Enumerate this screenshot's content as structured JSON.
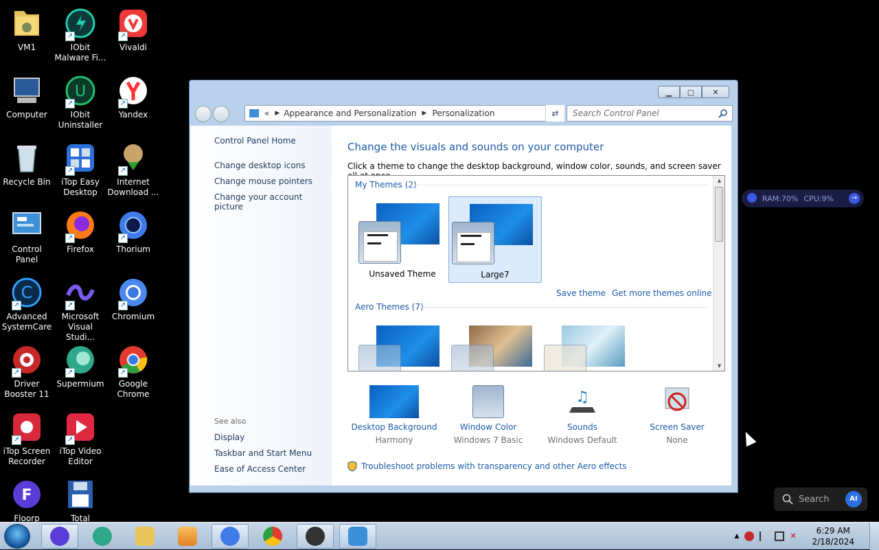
{
  "desktop": {
    "icons": [
      {
        "label": "VM1"
      },
      {
        "label": "IObit Malware Fi..."
      },
      {
        "label": "Vivaldi"
      },
      {
        "label": "Computer"
      },
      {
        "label": "IObit Uninstaller"
      },
      {
        "label": "Yandex"
      },
      {
        "label": "Recycle Bin"
      },
      {
        "label": "iTop Easy Desktop"
      },
      {
        "label": "Internet Download ..."
      },
      {
        "label": "Control Panel"
      },
      {
        "label": "Firefox"
      },
      {
        "label": "Thorium"
      },
      {
        "label": "Advanced SystemCare"
      },
      {
        "label": "Microsoft Visual Studi..."
      },
      {
        "label": "Chromium"
      },
      {
        "label": "Driver Booster 11"
      },
      {
        "label": "Supermium"
      },
      {
        "label": "Google Chrome"
      },
      {
        "label": "iTop Screen Recorder"
      },
      {
        "label": "iTop Video Editor"
      },
      {
        "label": "Floorp"
      },
      {
        "label": "Total"
      }
    ]
  },
  "window": {
    "address": {
      "root": "«",
      "crumb1": "Appearance and Personalization",
      "crumb2": "Personalization"
    },
    "search_placeholder": "Search Control Panel",
    "help": "?",
    "left": {
      "home": "Control Panel Home",
      "links": [
        "Change desktop icons",
        "Change mouse pointers",
        "Change your account picture"
      ],
      "see_also": "See also",
      "see_links": [
        "Display",
        "Taskbar and Start Menu",
        "Ease of Access Center"
      ]
    },
    "main": {
      "title": "Change the visuals and sounds on your computer",
      "subtitle": "Click a theme to change the desktop background, window color, sounds, and screen saver all at once.",
      "my_themes": "My Themes (2)",
      "themes": [
        "Unsaved Theme",
        "Large7"
      ],
      "save_theme": "Save theme",
      "get_more": "Get more themes online",
      "aero_themes": "Aero Themes (7)",
      "settings": [
        {
          "title": "Desktop Background",
          "value": "Harmony"
        },
        {
          "title": "Window Color",
          "value": "Windows 7 Basic"
        },
        {
          "title": "Sounds",
          "value": "Windows Default"
        },
        {
          "title": "Screen Saver",
          "value": "None"
        }
      ],
      "troubleshoot": "Troubleshoot problems with transparency and other Aero effects"
    }
  },
  "widget": {
    "ram": "RAM:70%",
    "cpu": "CPU:9%"
  },
  "taskbar_search": {
    "placeholder": "Search",
    "ai": "AI"
  },
  "clock": {
    "time": "6:29 AM",
    "date": "2/18/2024"
  }
}
